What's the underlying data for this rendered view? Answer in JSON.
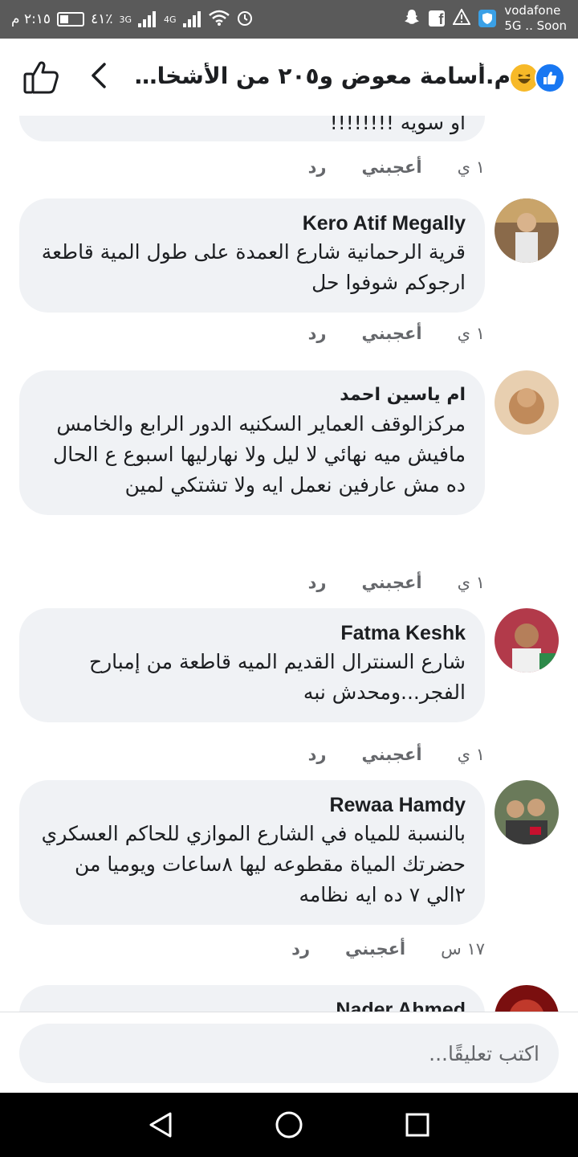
{
  "status_bar": {
    "time": "٢:١٥ م",
    "battery": "٤١٪",
    "network_1": "3G",
    "network_2": "4G",
    "carrier_line1": "vodafone",
    "carrier_line2": "5G .. Soon"
  },
  "header": {
    "title": "م.أسامة معوض و٢٠٥ من الأشخاص الآ...",
    "reactions": [
      "like",
      "haha"
    ],
    "back_icon": "chevron-left-icon",
    "like_icon": "thumbs-up-outline-icon"
  },
  "comments": [
    {
      "author": "",
      "text": "او سويه !!!!!!!!",
      "time": "١ ي",
      "like_label": "أعجبني",
      "reply_label": "رد"
    },
    {
      "author": "Kero Atif Megally",
      "text": "قرية الرحمانية شارع العمدة على طول المية قاطعة ارجوكم  شوفوا  حل",
      "time": "١ ي",
      "like_label": "أعجبني",
      "reply_label": "رد"
    },
    {
      "author": "ام ياسين احمد",
      "text": "مركزالوقف العماير السكنيه الدور الرابع والخامس مافيش ميه نهائي لا ليل ولا نهارليها اسبوع ع الحال ده مش عارفين نعمل ايه ولا تشتكي لمين",
      "time": "١ ي",
      "like_label": "أعجبني",
      "reply_label": "رد"
    },
    {
      "author": "Fatma Keshk",
      "text": "شارع السنترال القديم الميه قاطعة من إمبارح الفجر...ومحدش نبه",
      "time": "١ ي",
      "like_label": "أعجبني",
      "reply_label": "رد"
    },
    {
      "author": "Rewaa Hamdy",
      "text": "بالنسبة للمياه في الشارع الموازي للحاكم العسكري حضرتك المياة مقطوعه ليها ٨ساعات ويوميا من ٢الي ٧ ده ايه نظامه",
      "time": "١٧ س",
      "like_label": "أعجبني",
      "reply_label": "رد"
    },
    {
      "author": "Nader Ahmed",
      "text": "",
      "time": "",
      "like_label": "",
      "reply_label": ""
    }
  ],
  "composer": {
    "placeholder": "اكتب تعليقًا...",
    "value": ""
  },
  "colors": {
    "accent": "#1877f2",
    "bubble": "#f0f2f5",
    "secondary_text": "#65676b",
    "status_bar": "#5a5a5a"
  }
}
